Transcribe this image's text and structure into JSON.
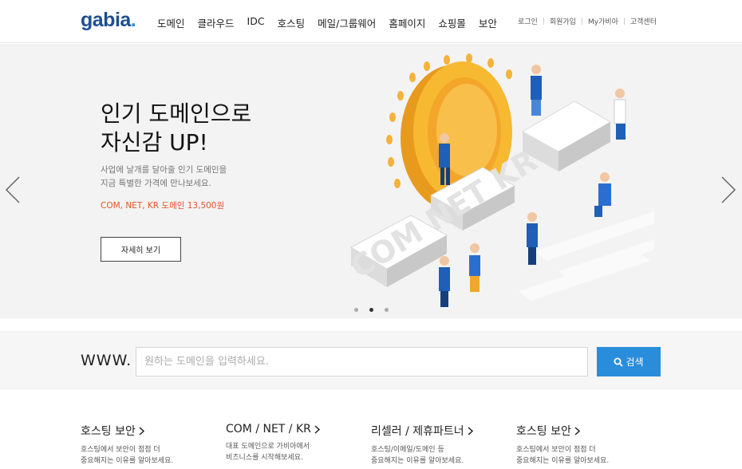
{
  "header": {
    "logo_text": "gabia",
    "logo_dot": ".",
    "nav": [
      "도메인",
      "클라우드",
      "IDC",
      "호스팅",
      "메일/그룹웨어",
      "홈페이지",
      "쇼핑몰",
      "보안"
    ],
    "util": [
      "로그인",
      "회원가입",
      "My가비아",
      "고객센터"
    ]
  },
  "hero": {
    "title_line1": "인기 도메인으로",
    "title_line2": "자신감 UP!",
    "desc_line1": "사업에 날개를 달아줄 인기 도메인을",
    "desc_line2": "지금 특별한 가격에 만나보세요.",
    "promo": "COM, NET, KR 도메인 13,500원",
    "button_label": "자세히 보기",
    "slide_count": 3,
    "active_slide": 2,
    "art_text": "COM NET KR",
    "accent_color": "#e8532a"
  },
  "search": {
    "prefix": "WWW.",
    "placeholder": "원하는 도메인을 입력하세요.",
    "button_label": "검색",
    "button_icon": "search-icon",
    "button_color": "#2a8ddc"
  },
  "cards": [
    {
      "title": "호스팅 보안",
      "desc1": "호스팅에서 보안이 점점 더",
      "desc2": "중요해지는 이유를 알아보세요."
    },
    {
      "title": "COM / NET / KR",
      "desc1": "대표 도메인으로 가비아에서",
      "desc2": "비즈니스를 시작해보세요."
    },
    {
      "title": "리셀러 / 제휴파트너",
      "desc1": "호스팅/이메일/도메인 등",
      "desc2": "중요해지는 이유를 알아보세요."
    },
    {
      "title": "호스팅 보안",
      "desc1": "호스팅에서 보안이 점점 더",
      "desc2": "중요해지는 이유를 알아보세요."
    }
  ]
}
